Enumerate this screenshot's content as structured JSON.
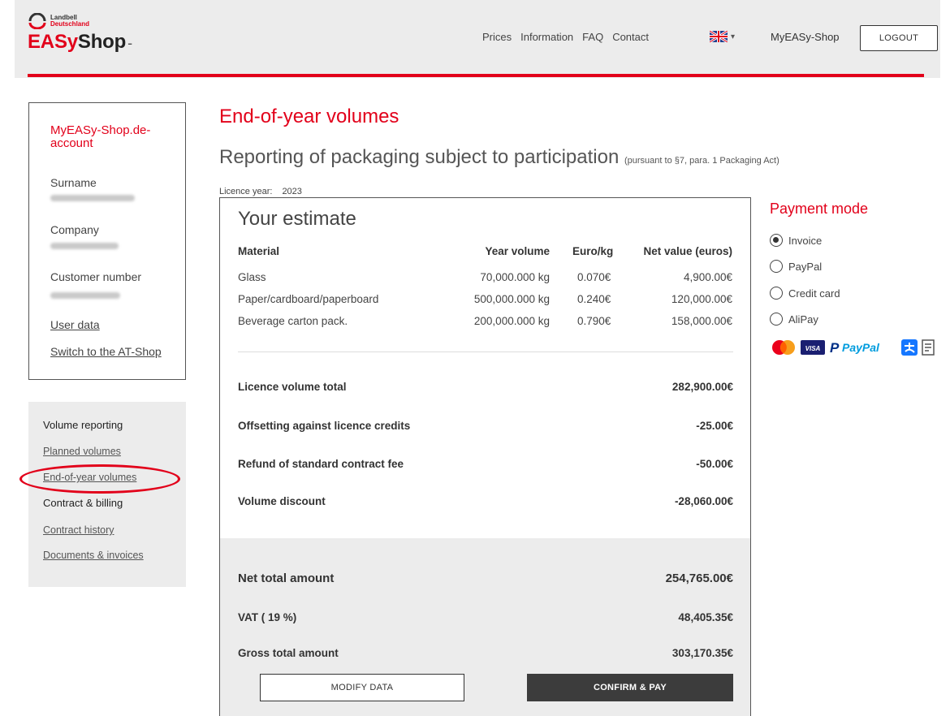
{
  "header": {
    "brand_line1": "Landbell",
    "brand_line2": "Deutschland",
    "shop_easy": "EASy",
    "shop_shop": "Shop",
    "shop_caret": "-",
    "nav": [
      "Prices",
      "Information",
      "FAQ",
      "Contact"
    ],
    "language_caret": "▾",
    "myeasy_label": "MyEASy-Shop",
    "logout_label": "LOGOUT"
  },
  "account": {
    "title": "MyEASy-Shop.de-account",
    "fields": [
      {
        "label": "Surname"
      },
      {
        "label": "Company"
      },
      {
        "label": "Customer number"
      }
    ],
    "links": [
      "User data",
      "Switch to the AT-Shop"
    ]
  },
  "sidemenu": {
    "section1": "Volume reporting",
    "planned": "Planned volumes",
    "endofyear": "End-of-year volumes",
    "section2": "Contract & billing",
    "history": "Contract history",
    "docs": "Documents & invoices"
  },
  "main": {
    "title": "End-of-year volumes",
    "subtitle": "Reporting of packaging subject to participation",
    "subtitle_note": "(pursuant to §7, para. 1 Packaging Act)",
    "licence_label": "Licence year:",
    "licence_year": "2023"
  },
  "estimate": {
    "title": "Your estimate",
    "headers": {
      "material": "Material",
      "volume": "Year volume",
      "rate": "Euro/kg",
      "net": "Net value (euros)"
    },
    "rows": [
      {
        "material": "Glass",
        "volume": "70,000.000 kg",
        "rate": "0.070€",
        "net": "4,900.00€"
      },
      {
        "material": "Paper/cardboard/paperboard",
        "volume": "500,000.000 kg",
        "rate": "0.240€",
        "net": "120,000.00€"
      },
      {
        "material": "Beverage carton pack.",
        "volume": "200,000.000 kg",
        "rate": "0.790€",
        "net": "158,000.00€"
      }
    ],
    "totals": [
      {
        "label": "Licence volume total",
        "value": "282,900.00€"
      },
      {
        "label": "Offsetting against licence credits",
        "value": "-25.00€"
      },
      {
        "label": "Refund of standard contract fee",
        "value": "-50.00€"
      },
      {
        "label": "Volume discount",
        "value": "-28,060.00€"
      }
    ],
    "net_total_label": "Net total amount",
    "net_total_value": "254,765.00€",
    "vat_label": "VAT ( 19 %)",
    "vat_value": "48,405.35€",
    "gross_label": "Gross total amount",
    "gross_value": "303,170.35€",
    "modify_label": "MODIFY DATA",
    "confirm_label": "CONFIRM & PAY"
  },
  "payment": {
    "title": "Payment mode",
    "options": [
      {
        "label": "Invoice",
        "selected": true
      },
      {
        "label": "PayPal",
        "selected": false
      },
      {
        "label": "Credit card",
        "selected": false
      },
      {
        "label": "AliPay",
        "selected": false
      }
    ],
    "logo_visa": "VISA",
    "logo_paypal_p": "P",
    "logo_paypal_text": "PayPal",
    "icons": [
      "mastercard-icon",
      "visa-icon",
      "paypal-icon",
      "alipay-icon",
      "invoice-icon"
    ]
  },
  "colors": {
    "accent": "#e2001a",
    "header_bg": "#ececec",
    "confirm_bg": "#3c3c3c"
  }
}
